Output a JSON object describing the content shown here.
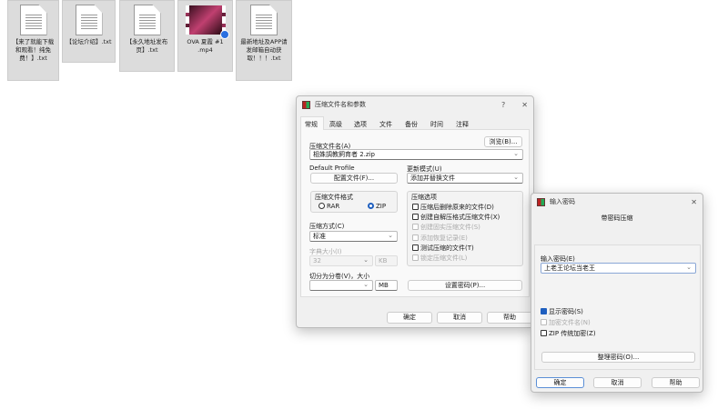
{
  "desktop": {
    "files": [
      {
        "name": "【来了就能下载和观看！纯免费！】.txt",
        "type": "txt"
      },
      {
        "name": "【论坛介绍】.txt",
        "type": "txt"
      },
      {
        "name": "【永久地址发布页】.txt",
        "type": "txt"
      },
      {
        "name": "OVA 夏霞 #1 .mp4",
        "type": "mp4"
      },
      {
        "name": "最新地址及APP请发邮箱自动获取！！！.txt",
        "type": "txt"
      }
    ]
  },
  "archive_dialog": {
    "title": "压缩文件名和参数",
    "help": "?",
    "close": "✕",
    "tabs": [
      "常规",
      "高级",
      "选项",
      "文件",
      "备份",
      "时间",
      "注释"
    ],
    "archive_name_label": "压缩文件名(A)",
    "browse": "浏览(B)...",
    "archive_name": "柤姝調教飼育者 2.zip",
    "default_profile": "Default Profile",
    "profile_button": "配置文件(F)...",
    "update_mode_label": "更新模式(U)",
    "update_mode": "添加并替换文件",
    "format_label": "压缩文件格式",
    "format_rar": "RAR",
    "format_zip": "ZIP",
    "format_selected": "ZIP",
    "method_label": "压缩方式(C)",
    "method": "标准",
    "dict_label": "字典大小(I)",
    "dict_value": "32",
    "dict_unit": "KB",
    "split_label": "切分为分卷(V)，大小",
    "split_value": "",
    "split_unit": "MB",
    "options_label": "压缩选项",
    "options": [
      {
        "label": "压缩后删除原来的文件(D)",
        "checked": false,
        "enabled": true
      },
      {
        "label": "创建自解压格式压缩文件(X)",
        "checked": false,
        "enabled": true
      },
      {
        "label": "创建固实压缩文件(S)",
        "checked": false,
        "enabled": false
      },
      {
        "label": "添加恢复记录(E)",
        "checked": false,
        "enabled": false
      },
      {
        "label": "测试压缩的文件(T)",
        "checked": false,
        "enabled": true
      },
      {
        "label": "锁定压缩文件(L)",
        "checked": false,
        "enabled": false
      }
    ],
    "set_password": "设置密码(P)...",
    "ok": "确定",
    "cancel": "取消",
    "help_btn": "帮助"
  },
  "password_dialog": {
    "title": "输入密码",
    "close": "✕",
    "heading": "带密码压缩",
    "password_label": "输入密码(E)",
    "password": "上老王论坛当老王",
    "show_password": "显示密码(S)",
    "encrypt_names": "加密文件名(N)",
    "zip_legacy": "ZIP 传统加密(Z)",
    "organize": "整理密码(O)...",
    "ok": "确定",
    "cancel": "取消",
    "help": "帮助"
  }
}
